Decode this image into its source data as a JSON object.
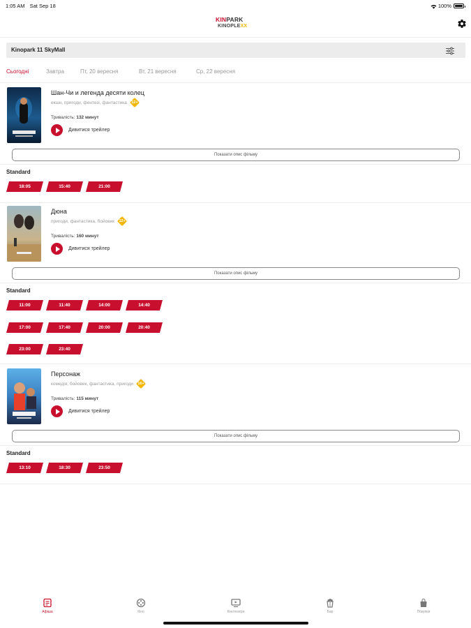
{
  "status_bar": {
    "time": "1:05 AM",
    "date": "Sat Sep 18",
    "battery": "100%"
  },
  "header": {
    "logo_top_red": "KIN",
    "logo_top_dark": "PARK",
    "logo_bottom": "KINOPLE",
    "logo_bottom_accent": "XX"
  },
  "cinema": {
    "name": "Kinopark 11 SkyMall"
  },
  "dates": [
    {
      "label": "Сьогодні",
      "active": true
    },
    {
      "label": "Завтра",
      "active": false
    },
    {
      "label": "Пт, 20 вересня",
      "active": false
    },
    {
      "label": "Вт, 21 вересня",
      "active": false
    },
    {
      "label": "Ср, 22 вересня",
      "active": false
    }
  ],
  "trailer_label": "Дивитися трейлер",
  "description_label": "Показати опис фільму",
  "movies": [
    {
      "title": "Шан-Чи и легенда десяти колец",
      "genres": "екшн, пригоди, фентезі, фантастика",
      "age": "12+",
      "duration_label": "Тривалість:",
      "duration_value": "132 минут",
      "format": "Standard",
      "sessions": [
        "18:05",
        "15:40",
        "21:00"
      ]
    },
    {
      "title": "Дюна",
      "genres": "пригоди, фантастика, бойовик",
      "age": "12+",
      "duration_label": "Тривалість:",
      "duration_value": "160 минут",
      "format": "Standard",
      "sessions": [
        "11:00",
        "11:40",
        "14:00",
        "14:40",
        "17:00",
        "17:40",
        "20:00",
        "20:40",
        "23:00",
        "23:40"
      ]
    },
    {
      "title": "Персонаж",
      "genres": "комедія, бойовик, фантастика, пригоди",
      "age": "16+",
      "duration_label": "Тривалість:",
      "duration_value": "115 минут",
      "format": "Standard",
      "sessions": [
        "13:10",
        "18:30",
        "23:50"
      ]
    }
  ],
  "tab_bar": [
    {
      "label": "Афіша",
      "icon": "ticket-icon",
      "active": true
    },
    {
      "label": "Кіно",
      "icon": "film-reel-icon",
      "active": false
    },
    {
      "label": "Кінотеатри",
      "icon": "screen-icon",
      "active": false
    },
    {
      "label": "Бар",
      "icon": "popcorn-icon",
      "active": false
    },
    {
      "label": "Покупки",
      "icon": "shopping-bag-icon",
      "active": false
    }
  ],
  "colors": {
    "accent": "#c8102e",
    "badge": "#f2b705",
    "tab_inactive": "#999999"
  }
}
